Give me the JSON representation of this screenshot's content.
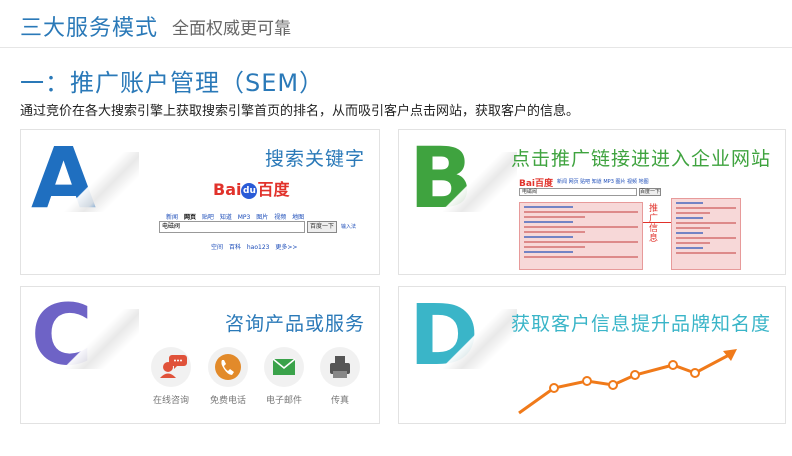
{
  "header": {
    "title": "三大服务模式",
    "subtitle": "全面权威更可靠"
  },
  "section": {
    "title": "一：推广账户管理（SEM）",
    "description": "通过竞价在各大搜索引擎上获取搜索引擎首页的排名，从而吸引客户点击网站，获取客户的信息。"
  },
  "cards": {
    "a": {
      "letter": "A",
      "title": "搜索关键字",
      "logo": {
        "part1": "Bai",
        "paw": "du",
        "part2": "百度"
      },
      "nav": [
        "新闻",
        "网页",
        "贴吧",
        "知道",
        "MP3",
        "图片",
        "视频",
        "地图"
      ],
      "query": "电磁阀",
      "button": "百度一下",
      "method": "输入法",
      "links": [
        "空间",
        "百科",
        "hao123",
        "更多>>"
      ]
    },
    "b": {
      "letter": "B",
      "title": "点击推广链接进进入企业网站",
      "logo": "Bai百度",
      "nav": "新闻 网页 贴吧 知道 MP3 图片 视频 地图",
      "query": "电磁阀",
      "button": "百度一下",
      "label": "推广信息"
    },
    "c": {
      "letter": "C",
      "title": "咨询产品或服务",
      "contacts": [
        {
          "label": "在线咨询",
          "icon": "chat-person-icon"
        },
        {
          "label": "免费电话",
          "icon": "phone-icon"
        },
        {
          "label": "电子邮件",
          "icon": "mail-icon"
        },
        {
          "label": "传真",
          "icon": "fax-icon"
        }
      ],
      "colors": {
        "chat": "#e0523a",
        "phone": "#e28a2a",
        "mail": "#3aa24a",
        "fax": "#555555"
      }
    },
    "d": {
      "letter": "D",
      "title": "获取客户信息提升品牌知名度",
      "trend_color": "#f07a1a"
    }
  },
  "colors": {
    "accent": "#2a79b8",
    "green": "#3fa33f",
    "teal": "#3ab5c8",
    "purple": "#6e63c6"
  }
}
